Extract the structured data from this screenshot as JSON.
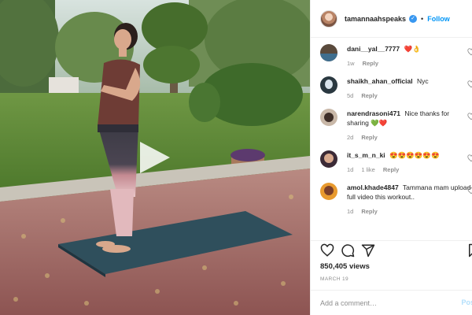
{
  "post": {
    "username": "tamannaahspeaks",
    "verified_icon": "verified-check-icon",
    "follow_label": "Follow",
    "separator": "•"
  },
  "comments": [
    {
      "username": "dani__yal__7777",
      "text": "❤️👌",
      "time": "1w",
      "likes": "",
      "reply_label": "Reply"
    },
    {
      "username": "shaikh_ahan_official",
      "text": "Nyc",
      "time": "5d",
      "likes": "",
      "reply_label": "Reply"
    },
    {
      "username": "narendrasoni471",
      "text": "Nice thanks for sharing 💚❤️",
      "time": "2d",
      "likes": "",
      "reply_label": "Reply"
    },
    {
      "username": "it_s_m_n_ki",
      "text": "😍😍😍😍😍😍",
      "time": "1d",
      "likes": "1 like",
      "reply_label": "Reply"
    },
    {
      "username": "amol.khade4847",
      "text": "Tammana mam upload full video this workout..",
      "time": "1d",
      "likes": "",
      "reply_label": "Reply"
    }
  ],
  "stats": {
    "views_count": "850,405",
    "views_label": "views",
    "date": "MARCH 19"
  },
  "composer": {
    "placeholder": "Add a comment…",
    "post_label": "Post"
  },
  "icons": {
    "like": "heart-icon",
    "comment": "comment-icon",
    "share": "share-icon",
    "save": "bookmark-icon",
    "play": "play-icon"
  },
  "colors": {
    "accent": "#0095f6",
    "verified": "#3897f0",
    "muted_text": "#8e8e8e",
    "post_disabled": "#b2dffc"
  }
}
